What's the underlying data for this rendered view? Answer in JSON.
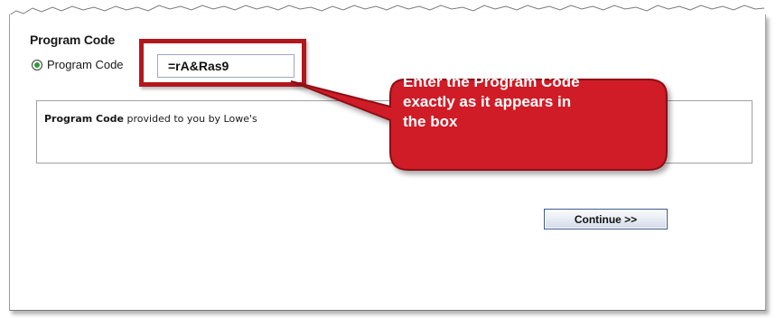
{
  "section": {
    "title": "Program Code"
  },
  "program_code": {
    "radio_label": "Program Code",
    "input_value": "=rA&Ras9"
  },
  "info": {
    "bold_text": "Program Code",
    "rest_text": " provided to you by Lowe's"
  },
  "callout": {
    "line1": "Enter the Program Code",
    "line2": "exactly as it appears in",
    "line3": "the box",
    "fill_color": "#cf1f25",
    "border_color": "#8e1015"
  },
  "actions": {
    "continue_label": "Continue >>"
  },
  "colors": {
    "highlight_border": "#b1171d",
    "button_border": "#3c5a8c",
    "radio_dot": "#2e9b3a"
  }
}
